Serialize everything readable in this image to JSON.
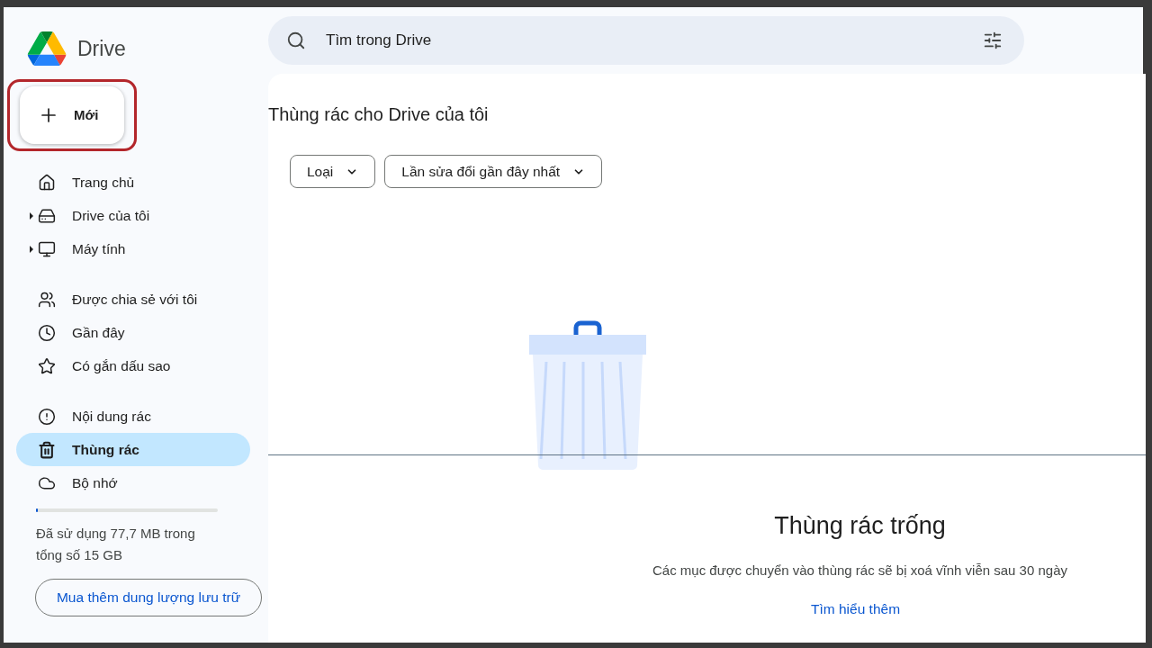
{
  "app": {
    "name": "Drive"
  },
  "new_button": {
    "label": "Mới"
  },
  "sidebar": {
    "groups": [
      {
        "items": [
          {
            "label": "Trang chủ",
            "expandable": false,
            "selected": false
          },
          {
            "label": "Drive của tôi",
            "expandable": true,
            "selected": false
          },
          {
            "label": "Máy tính",
            "expandable": true,
            "selected": false
          }
        ]
      },
      {
        "items": [
          {
            "label": "Được chia sẻ với tôi",
            "expandable": false,
            "selected": false
          },
          {
            "label": "Gần đây",
            "expandable": false,
            "selected": false
          },
          {
            "label": "Có gắn dấu sao",
            "expandable": false,
            "selected": false
          }
        ]
      },
      {
        "items": [
          {
            "label": "Nội dung rác",
            "expandable": false,
            "selected": false
          },
          {
            "label": "Thùng rác",
            "expandable": false,
            "selected": true
          },
          {
            "label": "Bộ nhớ",
            "expandable": false,
            "selected": false
          }
        ]
      }
    ]
  },
  "storage": {
    "level": 0.01,
    "text": "Đã sử dụng 77,7 MB trong tổng số 15 GB",
    "button": "Mua thêm dung lượng lưu trữ"
  },
  "search": {
    "placeholder": "Tìm trong Drive"
  },
  "page_title": "Thùng rác cho Drive của tôi",
  "filters": [
    {
      "label": "Loại"
    },
    {
      "label": "Lần sửa đổi gần đây nhất"
    }
  ],
  "empty_state": {
    "title": "Thùng rác trống",
    "message": "Các mục được chuyển vào thùng rác sẽ bị xoá vĩnh viễn sau 30 ngày",
    "link": "Tìm hiểu thêm"
  }
}
